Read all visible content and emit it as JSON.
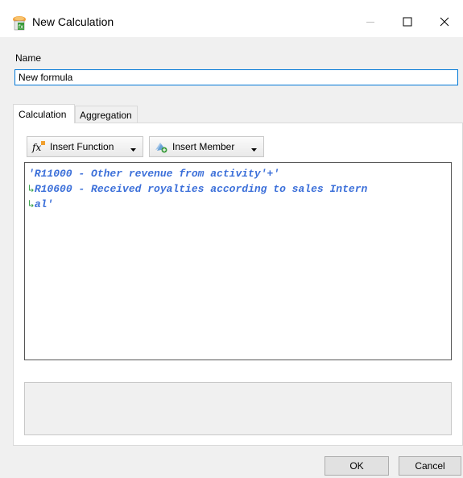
{
  "window": {
    "title": "New Calculation",
    "icon": "calculation-app-icon"
  },
  "name_section": {
    "label": "Name",
    "value": "New formula"
  },
  "tabs": [
    {
      "label": "Calculation",
      "active": true
    },
    {
      "label": "Aggregation",
      "active": false
    }
  ],
  "toolbar": {
    "insert_function_label": "Insert Function",
    "insert_member_label": "Insert Member"
  },
  "editor": {
    "line1": "'R11000 - Other revenue from activity'",
    "line1_op": "+",
    "line1_quote": "'",
    "line2": "R10600 - Received royalties according to sales Intern",
    "line3": "al'",
    "wrap_marker": "↳"
  },
  "buttons": {
    "ok": "OK",
    "cancel": "Cancel"
  },
  "colors": {
    "formula_text": "#3b6fd9",
    "wrap_marker": "#3aa14a",
    "focus_border": "#0078d7"
  }
}
